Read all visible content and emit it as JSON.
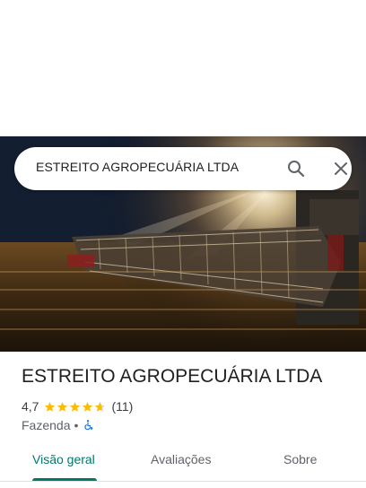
{
  "search": {
    "query": "ESTREITO AGROPECUÁRIA LTDA",
    "search_icon": "search-icon",
    "close_icon": "close-icon"
  },
  "place": {
    "name": "ESTREITO AGROPECUÁRIA LTDA",
    "rating": "4,7",
    "rating_value": 4.7,
    "stars_max": 5,
    "review_count": "(11)",
    "category": "Fazenda",
    "separator": "•",
    "accessibility_icon": "wheelchair-icon"
  },
  "colors": {
    "accent": "#00796b",
    "star": "#fbbc04",
    "text_primary": "#202124",
    "text_secondary": "#5f6368",
    "accessibility": "#1a73e8"
  },
  "tabs": [
    {
      "label": "Visão geral",
      "active": true
    },
    {
      "label": "Avaliações",
      "active": false
    },
    {
      "label": "Sobre",
      "active": false
    }
  ]
}
